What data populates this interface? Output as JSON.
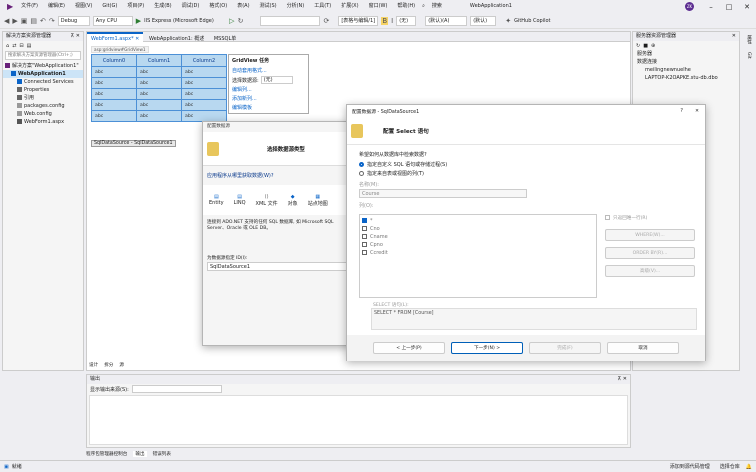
{
  "menu": [
    "文件(F)",
    "编辑(E)",
    "视图(V)",
    "Git(G)",
    "项目(P)",
    "生成(B)",
    "调试(D)",
    "格式(O)",
    "表(A)",
    "测试(S)",
    "分析(N)",
    "工具(T)",
    "扩展(X)",
    "窗口(W)",
    "帮助(H)"
  ],
  "search_label": "搜索",
  "app_title": "WebApplication1",
  "avatar_initials": "ZK",
  "toolbar": {
    "config": "Debug",
    "platform": "Any CPU",
    "run_label": "IIS Express (Microsoft Edge)",
    "dropdown2": "[表格与编辑/1]",
    "zoom": "(无)",
    "style": "(默认)(A)",
    "font_size": "(默认)",
    "copilot": "GitHub Copilot"
  },
  "solution_explorer": {
    "title": "解决方案资源管理器",
    "search_placeholder": "搜索解决方案资源管理器(Ctrl+;)",
    "items": [
      {
        "label": "解决方案\"WebApplication1\"",
        "indent": 0,
        "icon": "solution"
      },
      {
        "label": "WebApplication1",
        "indent": 1,
        "icon": "project",
        "bold": true
      },
      {
        "label": "Connected Services",
        "indent": 2,
        "icon": "service"
      },
      {
        "label": "Properties",
        "indent": 2,
        "icon": "wrench"
      },
      {
        "label": "引用",
        "indent": 2,
        "icon": "ref"
      },
      {
        "label": "packages.config",
        "indent": 2,
        "icon": "config"
      },
      {
        "label": "Web.config",
        "indent": 2,
        "icon": "config"
      },
      {
        "label": "WebForm1.aspx",
        "indent": 2,
        "icon": "page"
      }
    ]
  },
  "editor_tabs": [
    {
      "label": "WebForm1.aspx*",
      "active": true
    },
    {
      "label": "WebApplication1: 概述",
      "active": false
    },
    {
      "label": "MSSQL单",
      "active": false
    }
  ],
  "design": {
    "tag_label": "asp:gridview#GridView1",
    "grid_headers": [
      "Column0",
      "Column1",
      "Column2"
    ],
    "grid_rows": [
      [
        "abc",
        "abc",
        "abc"
      ],
      [
        "abc",
        "abc",
        "abc"
      ],
      [
        "abc",
        "abc",
        "abc"
      ],
      [
        "abc",
        "abc",
        "abc"
      ],
      [
        "abc",
        "abc",
        "abc"
      ]
    ],
    "datasource_label": "SqlDataSource - SqlDataSource1",
    "view_tabs": [
      "设计",
      "拆分",
      "源"
    ]
  },
  "gridview_tasks": {
    "title": "GridView 任务",
    "auto_format": "自动套用格式...",
    "choose_source_label": "选择数据源:",
    "choose_source_value": "(无)",
    "edit_columns": "编辑列...",
    "add_column": "添加新列...",
    "edit_templates": "编辑模板"
  },
  "wizard_back": {
    "title": "配置数据源",
    "heading": "选择数据源类型",
    "from_where": "应用程序从哪里获取数据(W)?",
    "types": [
      "Entity",
      "LINQ",
      "XML 文件",
      "对象",
      "站点地图"
    ],
    "description": "连接到 ADO.NET 支持的任何 SQL 数据库, 如 Microsoft SQL Server、Oracle 或 OLE DB。",
    "id_label": "为数据源指定 ID(I):",
    "id_value": "SqlDataSource1"
  },
  "wizard_front": {
    "title": "配置数据源 - SqlDataSource1",
    "help": "?",
    "close": "✕",
    "heading": "配置 Select 语句",
    "question": "希望如何从数据库中检索数据?",
    "option1": "指定自定义 SQL 语句或存储过程(S)",
    "option2": "指定来自表或视图的列(T)",
    "name_label": "名称(M):",
    "name_value": "Course",
    "columns_label": "列(O):",
    "columns": [
      {
        "label": "*",
        "checked": true
      },
      {
        "label": "Cno",
        "checked": false
      },
      {
        "label": "Cname",
        "checked": false
      },
      {
        "label": "Cpno",
        "checked": false
      },
      {
        "label": "Ccredit",
        "checked": false
      }
    ],
    "unique_rows": "只返回唯一行(R)",
    "where_btn": "WHERE(W)...",
    "orderby_btn": "ORDER BY(R)...",
    "advanced_btn": "高级(V)...",
    "select_label": "SELECT 语句(L):",
    "select_value": "SELECT * FROM [Course]",
    "btn_prev": "< 上一步(P)",
    "btn_next": "下一步(N) >",
    "btn_finish": "完成(F)",
    "btn_cancel": "取消"
  },
  "right_panel": {
    "title": "服务器资源管理器",
    "items": [
      {
        "label": "服务器",
        "indent": 0
      },
      {
        "label": "数据连接",
        "indent": 0
      },
      {
        "label": "meilingnewnuelhe",
        "indent": 1
      },
      {
        "label": "LAPTOP-K2OAPKE.stu-db.dbo",
        "indent": 1
      }
    ]
  },
  "output": {
    "title": "输出",
    "source_label": "显示输出来源(S):"
  },
  "bottom_tabs": [
    "程序包管理器控制台",
    "输出",
    "错误列表"
  ],
  "status": {
    "left": "就绪",
    "right": "添加到源代码管理",
    "right2": "选择仓库"
  }
}
